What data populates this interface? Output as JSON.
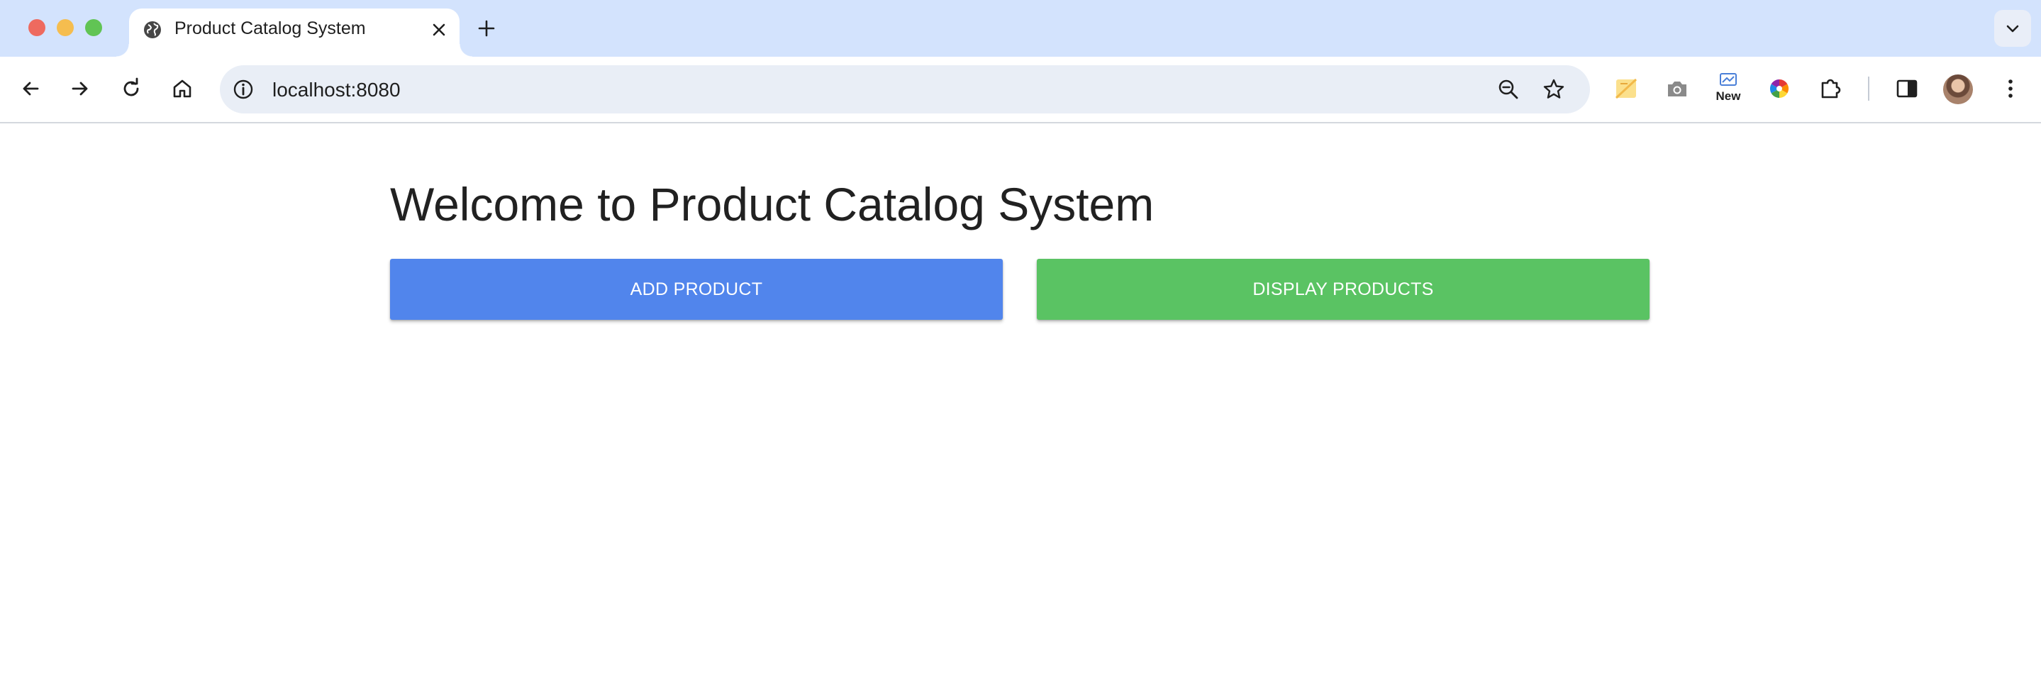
{
  "browser": {
    "tab": {
      "title": "Product Catalog System",
      "favicon": "globe-icon"
    },
    "address_bar": {
      "url": "localhost:8080"
    },
    "extensions": [
      {
        "name": "sticky-notes-icon"
      },
      {
        "name": "camera-icon"
      },
      {
        "name": "new-extension-icon",
        "badge": "New"
      },
      {
        "name": "color-wheel-icon"
      },
      {
        "name": "puzzle-icon"
      }
    ]
  },
  "page": {
    "title": "Welcome to Product Catalog System",
    "buttons": {
      "add_label": "ADD PRODUCT",
      "display_label": "DISPLAY PRODUCTS"
    }
  },
  "colors": {
    "tabstrip_bg": "#d3e3fd",
    "add_button": "#5185ec",
    "display_button": "#5ac363",
    "title_text": "#212121"
  }
}
